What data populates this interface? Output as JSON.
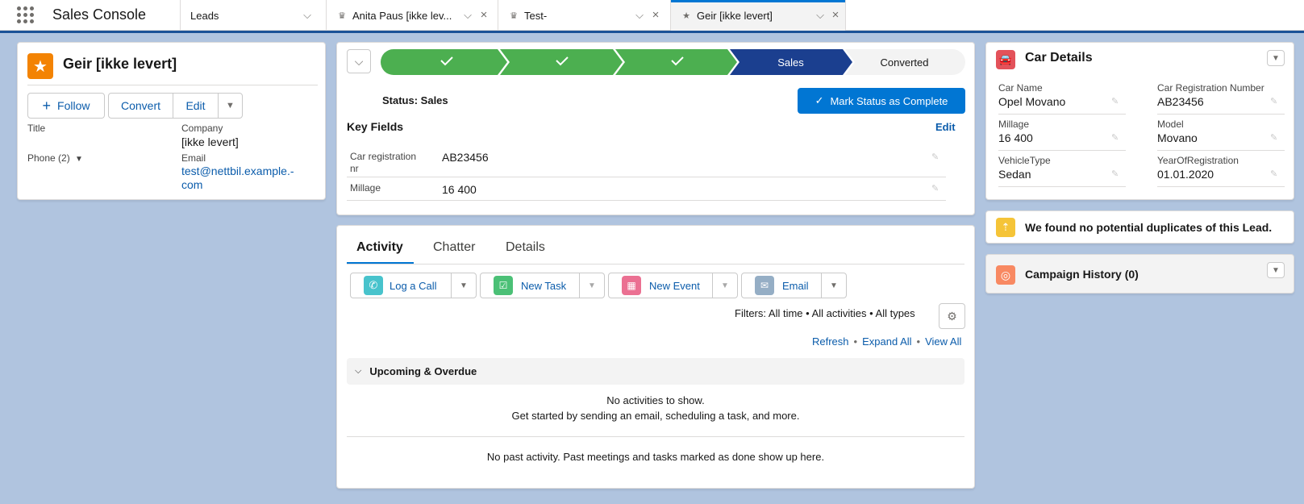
{
  "app": {
    "name": "Sales Console"
  },
  "tabs": [
    {
      "label": "Leads"
    },
    {
      "label": "Anita Paus [ikke lev..."
    },
    {
      "label": "Test-"
    },
    {
      "label": "Geir [ikke levert]"
    }
  ],
  "highlights": {
    "title": "Geir [ikke levert]",
    "buttons": {
      "follow": "Follow",
      "convert": "Convert",
      "edit": "Edit"
    },
    "fields": {
      "title_label": "Title",
      "company_label": "Company",
      "company_value": "[ikke levert]",
      "phone_label": "Phone (2)",
      "email_label": "Email",
      "email_line1": "test@nettbil.example.-",
      "email_line2": "com"
    }
  },
  "path": {
    "stages": [
      "Sales",
      "Converted"
    ],
    "status_text": "Status: Sales",
    "mark_button": "Mark Status as Complete",
    "key_fields_title": "Key Fields",
    "edit_link": "Edit",
    "fields": [
      {
        "label": "Car registration nr",
        "label_line1": "Car registration",
        "label_line2": "nr",
        "value": "AB23456"
      },
      {
        "label": "Millage",
        "value": "16 400"
      }
    ]
  },
  "activity": {
    "tabs": [
      "Activity",
      "Chatter",
      "Details"
    ],
    "actions": {
      "log_call": "Log a Call",
      "new_task": "New Task",
      "new_event": "New Event",
      "email": "Email"
    },
    "filters": "Filters: All time • All activities • All types",
    "links": {
      "refresh": "Refresh",
      "expand_all": "Expand All",
      "view_all": "View All",
      "sep": "•"
    },
    "upcoming": "Upcoming & Overdue",
    "empty_line1": "No activities to show.",
    "empty_line2": "Get started by sending an email, scheduling a task, and more.",
    "past": "No past activity. Past meetings and tasks marked as done show up here."
  },
  "car_details": {
    "title": "Car Details",
    "fields": {
      "car_name_label": "Car Name",
      "car_name_value": "Opel Movano",
      "reg_label": "Car Registration Number",
      "reg_value": "AB23456",
      "millage_label": "Millage",
      "millage_value": "16 400",
      "model_label": "Model",
      "model_value": "Movano",
      "type_label": "VehicleType",
      "type_value": "Sedan",
      "year_label": "YearOfRegistration",
      "year_value": "01.01.2020"
    }
  },
  "duplicates": {
    "text": "We found no potential duplicates of this Lead."
  },
  "campaign": {
    "title": "Campaign History (0)"
  },
  "colors": {
    "path_complete": "#4caf50",
    "path_current": "#1b3f8f",
    "brand_button": "#0176d3",
    "lead_icon": "#f38303",
    "car_icon": "#e3525a",
    "duplicate_icon": "#f5c438",
    "campaign_icon": "#f88962",
    "background": "#b0c4df"
  }
}
